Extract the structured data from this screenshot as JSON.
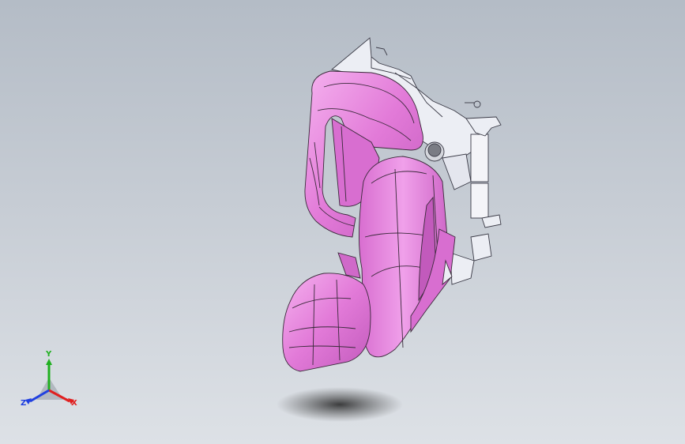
{
  "app": {
    "view": "isometric",
    "display_style": "shaded-with-edges"
  },
  "colors": {
    "background_top": "#b4bcc6",
    "background_bottom": "#dde1e6",
    "part_primary": "#e27ad8",
    "part_highlight": "#f5b2ef",
    "part_shadow": "#b04aa8",
    "frame": "#e8eaf2",
    "edge": "#3a2a3a",
    "axis_x": "#e02020",
    "axis_y": "#20b020",
    "axis_z": "#2040e0"
  },
  "triad": {
    "x_label": "X",
    "y_label": "Y",
    "z_label": "Z"
  },
  "model": {
    "icon": "car-seat-assembly",
    "parts": [
      "seat-cushion",
      "seat-back",
      "headrest",
      "side-bolster",
      "rear-frame",
      "hinge-mechanism",
      "recliner-knob"
    ]
  }
}
